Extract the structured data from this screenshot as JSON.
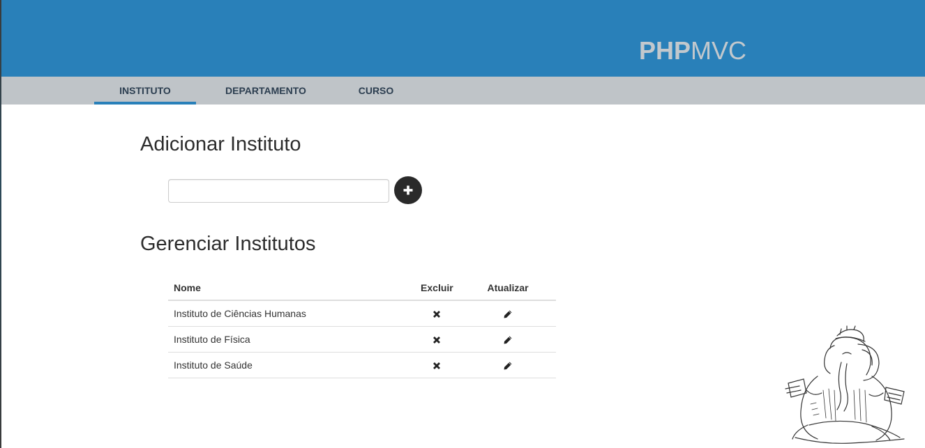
{
  "header": {
    "brand_bold": "PHP",
    "brand_light": "MVC",
    "color": "#2980b9"
  },
  "nav": {
    "tabs": [
      {
        "label": "INSTITUTO",
        "active": true
      },
      {
        "label": "DEPARTAMENTO",
        "active": false
      },
      {
        "label": "CURSO",
        "active": false
      }
    ]
  },
  "add_section": {
    "title": "Adicionar Instituto",
    "input_value": "",
    "input_placeholder": "",
    "add_icon": "plus-icon"
  },
  "manage_section": {
    "title": "Gerenciar Institutos",
    "columns": [
      "Nome",
      "Excluir",
      "Atualizar"
    ],
    "rows": [
      {
        "name": "Instituto de Ciências Humanas",
        "delete_icon": "close-icon",
        "update_icon": "pencil-icon"
      },
      {
        "name": "Instituto de Física",
        "delete_icon": "close-icon",
        "update_icon": "pencil-icon"
      },
      {
        "name": "Instituto de Saúde",
        "delete_icon": "close-icon",
        "update_icon": "pencil-icon"
      }
    ]
  },
  "mascot": {
    "icon": "elephant-mascot-sketch"
  }
}
